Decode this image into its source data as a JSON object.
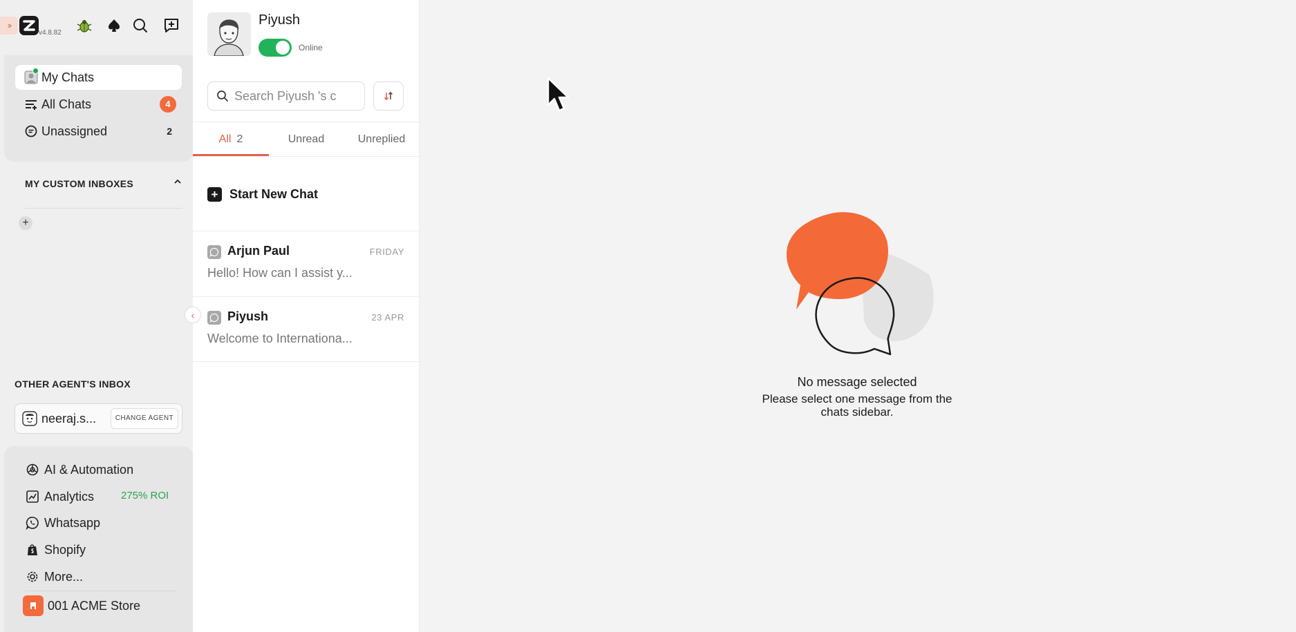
{
  "app": {
    "version": "v4.8.82",
    "accent_color": "#f26a3d",
    "online_color": "#22b35a"
  },
  "nav": {
    "items": [
      {
        "label": "My Chats",
        "icon": "avatar-icon",
        "active": true
      },
      {
        "label": "All Chats",
        "icon": "filter-lines-icon",
        "badge": "4"
      },
      {
        "label": "Unassigned",
        "icon": "chat-bubble-icon",
        "count": "2"
      }
    ]
  },
  "custom_inboxes": {
    "title": "MY CUSTOM INBOXES",
    "add_symbol": "+"
  },
  "other_agent": {
    "title": "OTHER AGENT'S INBOX",
    "agent_name": "neeraj.s...",
    "change_label": "CHANGE AGENT"
  },
  "bottom_nav": {
    "items": [
      {
        "label": "AI & Automation",
        "icon": "ai-swirl-icon"
      },
      {
        "label": "Analytics",
        "icon": "chart-icon",
        "tag": "275% ROI"
      },
      {
        "label": "Whatsapp",
        "icon": "whatsapp-icon"
      },
      {
        "label": "Shopify",
        "icon": "shopify-icon"
      },
      {
        "label": "More...",
        "icon": "gear-icon"
      }
    ],
    "store": "001 ACME Store"
  },
  "profile": {
    "name": "Piyush",
    "status": "Online"
  },
  "search": {
    "placeholder": "Search Piyush 's c"
  },
  "tabs": [
    {
      "label": "All",
      "count": "2",
      "active": true
    },
    {
      "label": "Unread"
    },
    {
      "label": "Unreplied"
    }
  ],
  "start_new_chat": "Start New Chat",
  "conversations": [
    {
      "name": "Arjun Paul",
      "date": "FRIDAY",
      "preview": "Hello! How can I assist y..."
    },
    {
      "name": "Piyush",
      "date": "23 APR",
      "preview": "Welcome to Internationa..."
    }
  ],
  "empty_state": {
    "title": "No message selected",
    "subtitle_line1": "Please select one message from the",
    "subtitle_line2": "chats sidebar."
  }
}
